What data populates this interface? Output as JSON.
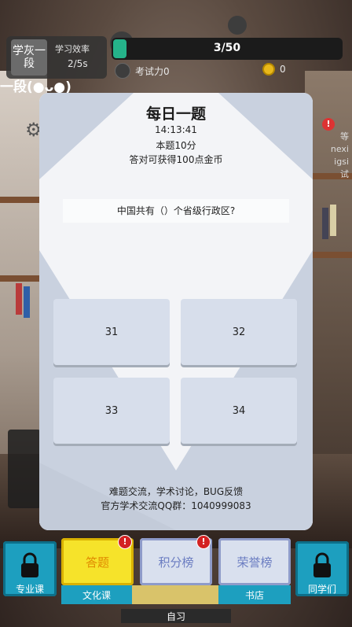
{
  "hud": {
    "rank": "学灰一段",
    "efficiency_label": "学习效率",
    "efficiency_value": "2/5s",
    "progress_text": "3/50",
    "progress_fraction": 0.06,
    "exam_power": "考试力0",
    "coins": "0",
    "segment": "一段(●ᴗ●)"
  },
  "side": {
    "right_text_1": "等",
    "right_text_2": "nexi",
    "right_text_3": "igsi",
    "right_text_4": "试"
  },
  "modal": {
    "title": "每日一题",
    "time": "14:13:41",
    "score": "本题10分",
    "reward": "答对可获得100点金币",
    "question": "中国共有（）个省级行政区?",
    "answers": [
      "31",
      "32",
      "33",
      "34"
    ],
    "footer_line1": "难题交流，学术讨论，BUG反馈",
    "footer_line2": "官方学术交流QQ群：1040999083"
  },
  "bottom": {
    "professional": "专业课",
    "culture": "文化课",
    "answer_tab": "答题",
    "rank_tab": "积分榜",
    "honor_tab": "荣誉榜",
    "bookstore": "书店",
    "classmates": "同学们",
    "study": "自习",
    "badge": "!"
  },
  "colors": {
    "progress": "#25b38a",
    "coin": "#e9b81b",
    "answer_tab_bg": "#f6e32a",
    "tab_bg": "#d9e0ee",
    "lock_tile": "#1d9fbf",
    "modal_bg": "#f3f4f7",
    "answer_bg": "#d7deeb"
  }
}
